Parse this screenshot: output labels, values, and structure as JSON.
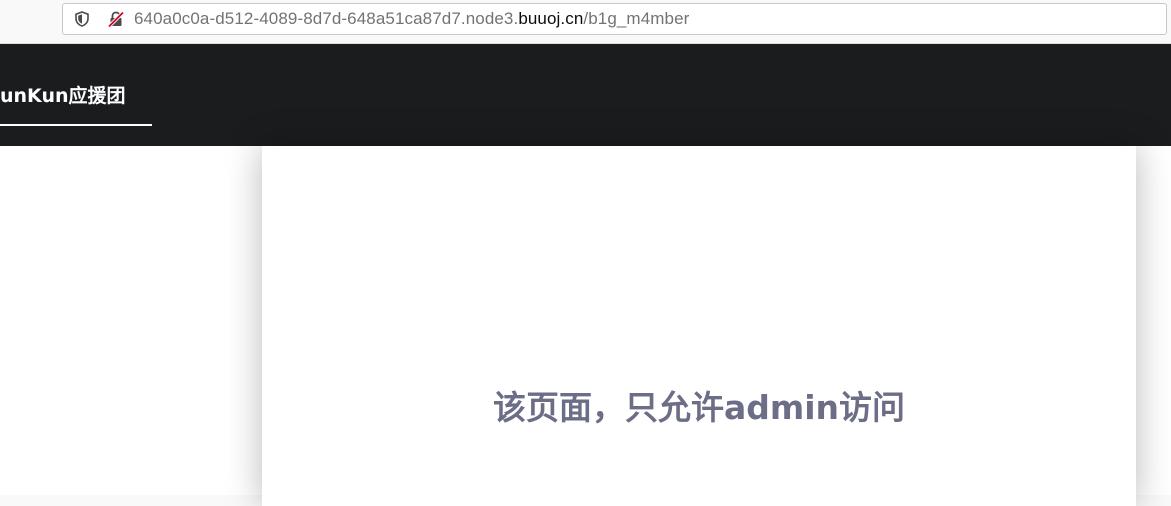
{
  "browser": {
    "url_subdomain": "640a0c0a-d512-4089-8d7d-648a51ca87d7.node3.",
    "url_domain": "buuoj.cn",
    "url_path": "/b1g_m4mber"
  },
  "navbar": {
    "brand": "unKun应援团"
  },
  "main": {
    "message": "该页面，只允许admin访问"
  },
  "colors": {
    "navbar_bg": "#1b1c1e",
    "message_text": "#6b6e86",
    "insecure_lock_accent": "#d70022"
  }
}
